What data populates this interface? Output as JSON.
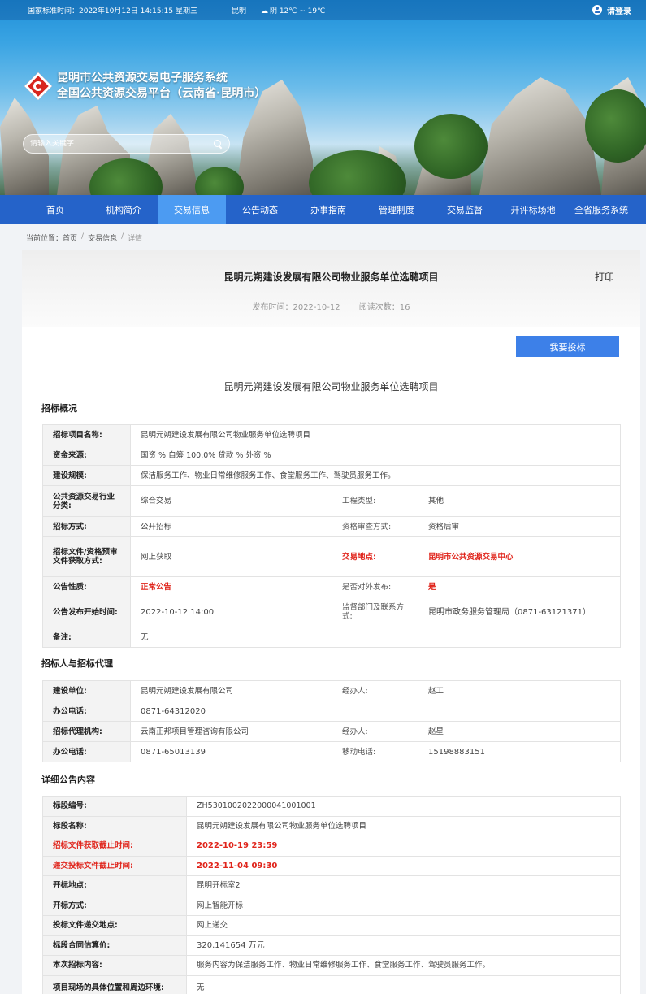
{
  "topbar": {
    "time": "国家标准时间：2022年10月12日 14:15:15 星期三",
    "city": "昆明",
    "weather": "阴 12℃ ~ 19℃",
    "login": "请登录"
  },
  "logo": {
    "line1": "昆明市公共资源交易电子服务系统",
    "line2": "全国公共资源交易平台（云南省·昆明市）"
  },
  "search": {
    "placeholder": "请输入关键字"
  },
  "nav": [
    "首页",
    "机构简介",
    "交易信息",
    "公告动态",
    "办事指南",
    "管理制度",
    "交易监督",
    "开评标场地",
    "全省服务系统"
  ],
  "nav_active": "交易信息",
  "breadcrumb": {
    "label": "当前位置：",
    "home": "首页",
    "section": "交易信息",
    "current": "详情"
  },
  "page": {
    "title": "昆明元朔建设发展有限公司物业服务单位选聘项目",
    "print": "打印",
    "publish_time": "发布时间：2022-10-12",
    "read_count": "阅读次数：16",
    "bid_button": "我要投标",
    "subtitle": "昆明元朔建设发展有限公司物业服务单位选聘项目"
  },
  "section1": {
    "title": "招标概况",
    "project_name_label": "招标项目名称:",
    "project_name": "昆明元朔建设发展有限公司物业服务单位选聘项目",
    "fund_label": "资金来源:",
    "fund": "国资 % 自筹 100.0% 贷款 % 外资 %",
    "scale_label": "建设规模:",
    "scale": "保洁服务工作、物业日常维修服务工作、食堂服务工作、驾驶员服务工作。",
    "category_label": "公共资源交易行业分类:",
    "category": "综合交易",
    "eng_type_label": "工程类型:",
    "eng_type": "其他",
    "method_label": "招标方式:",
    "method": "公开招标",
    "qual_label": "资格审查方式:",
    "qual": "资格后审",
    "doc_get_label": "招标文件/资格预审文件获取方式:",
    "doc_get": "网上获取",
    "place_label": "交易地点:",
    "place": "昆明市公共资源交易中心",
    "nature_label": "公告性质:",
    "nature": "正常公告",
    "external_label": "是否对外发布:",
    "external": "是",
    "start_label": "公告发布开始时间:",
    "start": "2022-10-12 14:00",
    "supervisor_label": "监督部门及联系方式:",
    "supervisor": "昆明市政务服务管理局（0871-63121371）",
    "remark_label": "备注:",
    "remark": "无"
  },
  "section2": {
    "title": "招标人与招标代理",
    "unit_label": "建设单位:",
    "unit": "昆明元朔建设发展有限公司",
    "handler1_label": "经办人:",
    "handler1": "赵工",
    "phone1_label": "办公电话:",
    "phone1": "0871-64312020",
    "agency_label": "招标代理机构:",
    "agency": "云南正邦项目管理咨询有限公司",
    "handler2_label": "经办人:",
    "handler2": "赵星",
    "phone2_label": "办公电话:",
    "phone2": "0871-65013139",
    "mobile_label": "移动电话:",
    "mobile": "15198883151"
  },
  "section3": {
    "title": "详细公告内容",
    "rows": [
      {
        "label": "标段编号:",
        "value": "ZH5301002022000041001001"
      },
      {
        "label": "标段名称:",
        "value": "昆明元朔建设发展有限公司物业服务单位选聘项目"
      },
      {
        "label": "招标文件获取截止时间:",
        "value": "2022-10-19 23:59"
      },
      {
        "label": "递交投标文件截止时间:",
        "value": "2022-11-04 09:30"
      },
      {
        "label": "开标地点:",
        "value": "昆明开标室2"
      },
      {
        "label": "开标方式:",
        "value": "网上智能开标"
      },
      {
        "label": "投标文件递交地点:",
        "value": "网上递交"
      },
      {
        "label": "标段合同估算价:",
        "value": "320.141654 万元"
      },
      {
        "label": "本次招标内容:",
        "value": "服务内容为保洁服务工作、物业日常维修服务工作、食堂服务工作、驾驶员服务工作。"
      },
      {
        "label": "项目现场的具体位置和周边环境:",
        "value": "无"
      }
    ]
  }
}
